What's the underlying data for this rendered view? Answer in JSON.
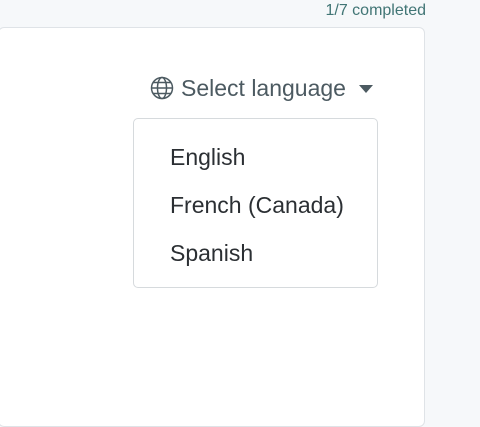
{
  "progress": {
    "text": "1/7 completed"
  },
  "language_selector": {
    "label": "Select language",
    "icon": "globe-icon",
    "caret_icon": "caret-down-icon",
    "options": [
      "English",
      "French (Canada)",
      "Spanish"
    ]
  },
  "colors": {
    "accent": "#417575",
    "text": "#4c5a61"
  }
}
